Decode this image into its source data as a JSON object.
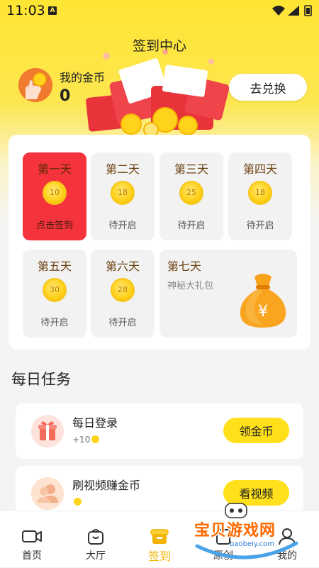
{
  "status_bar": {
    "time": "11:03",
    "notification_badge": "A"
  },
  "header": {
    "title": "签到中心",
    "coins_label": "我的金币",
    "coins_value": "0",
    "exchange_label": "去兑换"
  },
  "checkin": {
    "days": [
      {
        "title": "第一天",
        "coins": "10",
        "status": "点击签到"
      },
      {
        "title": "第二天",
        "coins": "18",
        "status": "待开启"
      },
      {
        "title": "第三天",
        "coins": "25",
        "status": "待开启"
      },
      {
        "title": "第四天",
        "coins": "18",
        "status": "待开启"
      },
      {
        "title": "第五天",
        "coins": "30",
        "status": "待开启"
      },
      {
        "title": "第六天",
        "coins": "28",
        "status": "待开启"
      }
    ],
    "day7": {
      "title": "第七天",
      "subtitle": "神秘大礼包"
    }
  },
  "tasks": {
    "title": "每日任务",
    "items": [
      {
        "name": "每日登录",
        "reward": "+10",
        "button": "领金币",
        "icon": "gift-icon"
      },
      {
        "name": "刷视频赚金币",
        "reward": "",
        "button": "看视频",
        "icon": "users-icon"
      }
    ]
  },
  "bottom_nav": [
    {
      "label": "首页",
      "icon": "video-icon"
    },
    {
      "label": "大厅",
      "icon": "smile-bag-icon"
    },
    {
      "label": "签到",
      "icon": "signin-icon"
    },
    {
      "label": "原创",
      "icon": "original-icon"
    },
    {
      "label": "我的",
      "icon": "user-icon"
    }
  ],
  "watermark": {
    "text": "宝贝游戏网",
    "url": "baobeiy.com"
  },
  "colors": {
    "accent_yellow": "#ffe01a",
    "active_day_red": "#f5333c",
    "nav_active": "#f2b400"
  }
}
